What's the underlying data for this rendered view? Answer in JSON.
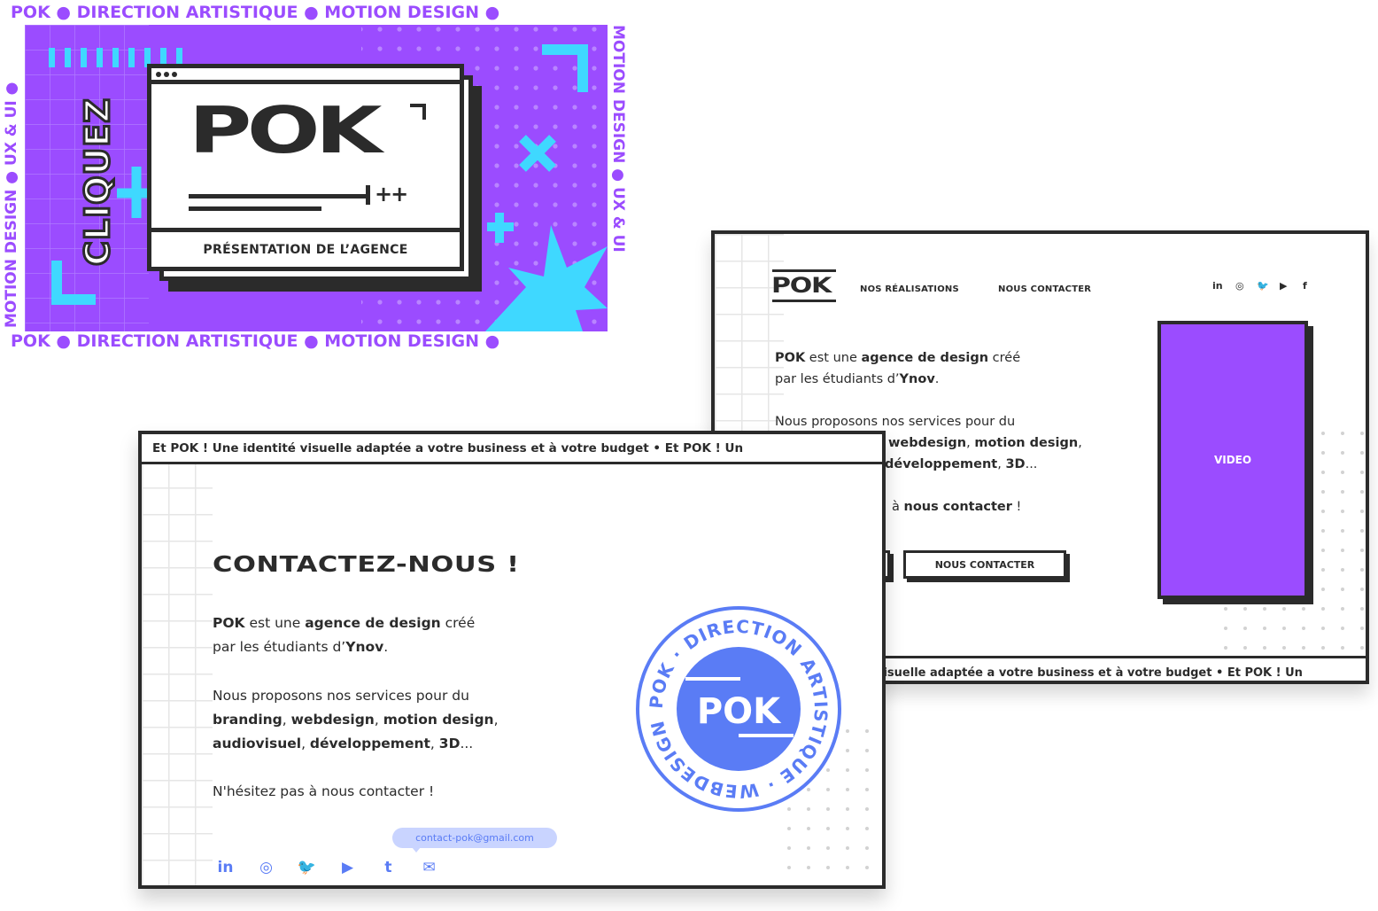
{
  "banner": {
    "frame_text": "POK ● DIRECTION ARTISTIQUE ● MOTION DESIGN ●",
    "frame_side_left": "MOTION DESIGN ● UX & UI ●",
    "frame_side_right": "MOTION DESIGN ● UX & UI",
    "vertical_label": "CLIQUEZ",
    "logo": "POK",
    "logo_suffix": "++",
    "caption": "PRÉSENTATION DE L’AGENCE",
    "colors": {
      "accent": "#9b4cff",
      "secondary": "#3fd8ff",
      "ink": "#2b2b2b"
    }
  },
  "site": {
    "logo": "POK",
    "nav": [
      "NOS RÉALISATIONS",
      "NOUS CONTACTER"
    ],
    "social": [
      "in",
      "◎",
      "🐦",
      "▶",
      "f"
    ],
    "intro_1a": "POK",
    "intro_1b": " est une ",
    "intro_1c": "agence de design",
    "intro_1d": " créé",
    "intro_2a": "par les étudiants d’",
    "intro_2b": "Ynov",
    "intro_2c": ".",
    "services_1": "Nous proposons nos services pour du",
    "services_2a": "webdesign",
    "services_2b": ", ",
    "services_2c": "motion design",
    "services_2d": ",",
    "services_3a": "développement",
    "services_3b": ", ",
    "services_3c": "3D",
    "services_3d": "...",
    "cta_1": "à ",
    "cta_2": "nous contacter",
    "cta_3": " !",
    "button": "NOUS CONTACTER",
    "video": "VIDEO",
    "marquee": "visuelle adaptée a votre business et à votre budget  •  Et POK ! Un"
  },
  "contact": {
    "marquee": "Et POK ! Une identité visuelle adaptée a votre business et à votre budget  •  Et POK ! Un",
    "title": "CONTACTEZ-NOUS !",
    "intro_1a": "POK",
    "intro_1b": " est une ",
    "intro_1c": "agence de design",
    "intro_1d": " créé",
    "intro_2a": "par les étudiants d’",
    "intro_2b": "Ynov",
    "intro_2c": ".",
    "services_1": "Nous proposons nos services pour du",
    "services_2a": "branding",
    "services_2b": ", ",
    "services_2c": "webdesign",
    "services_2d": ", ",
    "services_2e": "motion design",
    "services_2f": ",",
    "services_3a": "audiovisuel",
    "services_3b": ", ",
    "services_3c": "développement",
    "services_3d": ", ",
    "services_3e": "3D",
    "services_3f": "...",
    "closing": "N'hésitez pas à nous contacter !",
    "email": "contact-pok@gmail.com",
    "icons": [
      "in",
      "◎",
      "🐦",
      "▶",
      "t",
      "✉"
    ],
    "stamp_logo": "POK",
    "stamp_ring": "POK · DIRECTION ARTISTIQUE · WEBDESIGN ·",
    "stamp_color": "#5a7cf5"
  }
}
